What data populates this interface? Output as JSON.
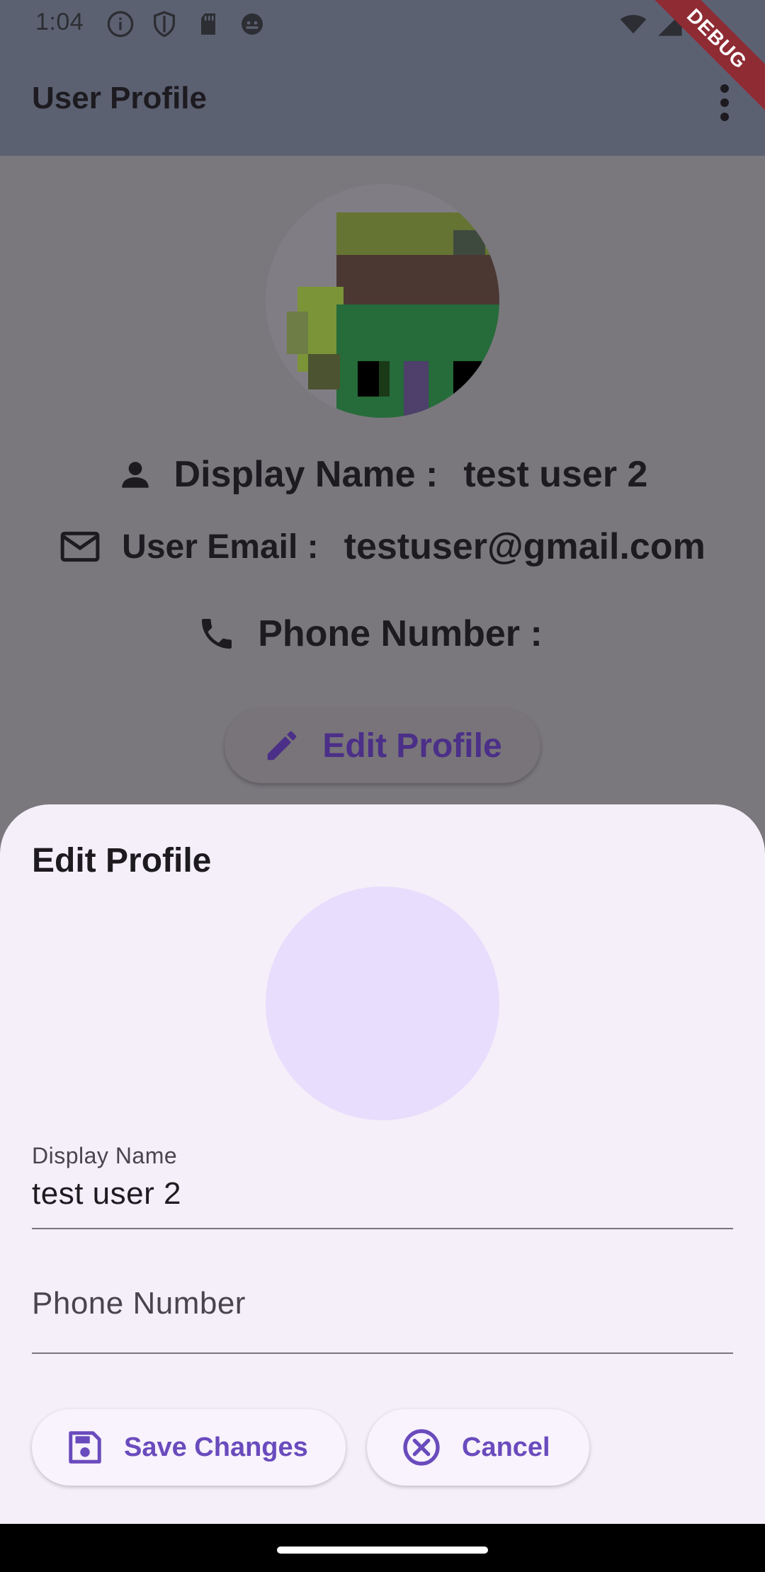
{
  "status_bar": {
    "time": "1:04"
  },
  "app_bar": {
    "title": "User Profile",
    "debug_label": "DEBUG"
  },
  "profile": {
    "display_name_label": "Display Name :",
    "display_name_value": "test user 2",
    "email_label": "User Email :",
    "email_value": "testuser@gmail.com",
    "phone_label": "Phone Number :",
    "phone_value": "",
    "edit_button_label": "Edit Profile"
  },
  "sheet": {
    "title": "Edit Profile",
    "display_name_field": {
      "label": "Display Name",
      "value": "test user 2"
    },
    "phone_field": {
      "placeholder": "Phone Number",
      "value": ""
    },
    "save_label": "Save Changes",
    "cancel_label": "Cancel"
  },
  "colors": {
    "accent": "#6a4bbd",
    "sheet_background": "#f4eff9",
    "scrim_background": "#7a787d",
    "avatar_placeholder": "#e8ddfd"
  },
  "icons": {
    "status": [
      "info-icon",
      "shield-icon",
      "sd-card-icon",
      "android-icon",
      "wifi-icon",
      "signal-icon",
      "battery-icon"
    ],
    "menu": "more-vert-icon",
    "profile_rows": [
      "person-icon",
      "mail-icon",
      "phone-icon"
    ],
    "edit": "pencil-icon",
    "save": "save-icon",
    "cancel": "cancel-circle-icon"
  }
}
